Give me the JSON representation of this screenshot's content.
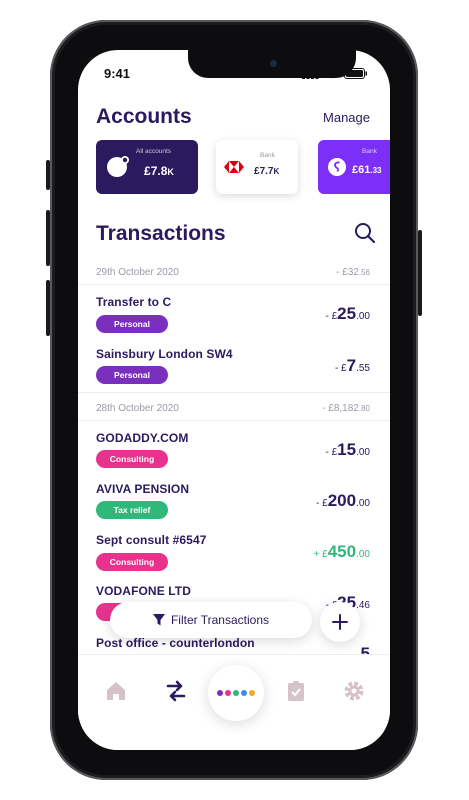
{
  "status": {
    "time": "9:41"
  },
  "accounts": {
    "title": "Accounts",
    "manage_label": "Manage",
    "cards": [
      {
        "label": "All accounts",
        "currency": "£",
        "value": "7.8",
        "suffix": "K",
        "bg": "#2b1a5e"
      },
      {
        "label": "Bank",
        "currency": "£",
        "value": "7.7",
        "suffix": "K",
        "bg": "#ffffff"
      },
      {
        "label": "Bank",
        "currency": "£",
        "value": "61",
        "suffix": ".33",
        "bg": "#7b2ff7"
      }
    ]
  },
  "transactions": {
    "title": "Transactions",
    "groups": [
      {
        "date": "29th October 2020",
        "total_prefix": "- £",
        "total_main": "32",
        "total_dec": ".56"
      },
      {
        "date": "28th October 2020",
        "total_prefix": "- £",
        "total_main": "8,182",
        "total_dec": ".80"
      }
    ],
    "items": [
      {
        "name": "Transfer to C",
        "tag": "Personal",
        "sign": "- £",
        "main": "25",
        "dec": ".00"
      },
      {
        "name": "Sainsbury London SW4",
        "tag": "Personal",
        "sign": "- £",
        "main": "7",
        "dec": ".55"
      },
      {
        "name": "GODADDY.COM",
        "tag": "Consulting",
        "sign": "- £",
        "main": "15",
        "dec": ".00"
      },
      {
        "name": "AVIVA PENSION",
        "tag": "Tax relief",
        "sign": "- £",
        "main": "200",
        "dec": ".00"
      },
      {
        "name": "Sept consult #6547",
        "tag": "Consulting",
        "sign": "+ £",
        "main": "450",
        "dec": ".00"
      },
      {
        "name": "VODAFONE LTD",
        "tag": "",
        "sign": "- £",
        "main": "25",
        "dec": ".46"
      },
      {
        "name": "Post office - counterlondon",
        "tag": "",
        "sign": "",
        "main": "5",
        "dec": ""
      }
    ]
  },
  "filter_label": "Filter Transactions",
  "colors": {
    "primary": "#2b1a5e",
    "personal": "#7b2fbe",
    "consulting": "#e8338e",
    "tax_relief": "#2eb87a",
    "income": "#2eb87a",
    "nav_icon": "#d6c3c8"
  },
  "icons": [
    "search-icon",
    "filter-icon",
    "plus-icon",
    "home-icon",
    "transfer-icon",
    "receipt-icon",
    "gear-icon"
  ]
}
